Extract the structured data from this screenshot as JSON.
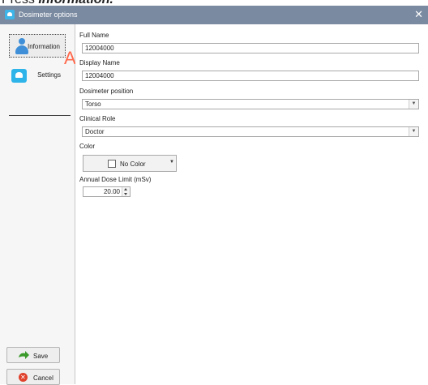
{
  "caption": {
    "prefix": "Press ",
    "emphasis": "Information."
  },
  "window": {
    "title": "Dosimeter options",
    "close_glyph": "✕"
  },
  "sidebar": {
    "items": [
      {
        "label": "Information",
        "icon": "person-icon"
      },
      {
        "label": "Settings",
        "icon": "settings-icon"
      }
    ],
    "pointer_glyph": "A",
    "save_label": "Save",
    "cancel_label": "Cancel"
  },
  "form": {
    "full_name": {
      "label": "Full Name",
      "value": "12004000"
    },
    "display_name": {
      "label": "Display Name",
      "value": "12004000"
    },
    "position": {
      "label": "Dosimeter position",
      "value": "Torso"
    },
    "role": {
      "label": "Clinical Role",
      "value": "Doctor"
    },
    "color": {
      "label": "Color",
      "value": "No Color"
    },
    "dose_limit": {
      "label": "Annual Dose Limit (mSv)",
      "value": "20.00"
    }
  },
  "colors": {
    "titlebar": "#7a8aa0",
    "accent_blue": "#3f8fd8",
    "pointer": "#ff6a4d",
    "save_green": "#3a9a2a",
    "cancel_red": "#e0412c"
  }
}
